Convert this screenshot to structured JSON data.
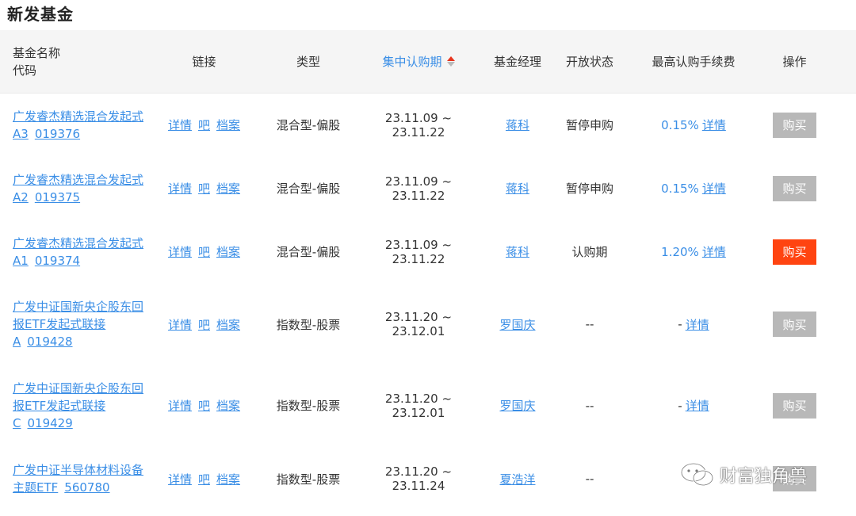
{
  "page_title": "新发基金",
  "headers": {
    "name": "基金名称",
    "code": "代码",
    "links": "链接",
    "type": "类型",
    "period": "集中认购期",
    "manager": "基金经理",
    "status": "开放状态",
    "fee": "最高认购手续费",
    "op": "操作"
  },
  "link_labels": {
    "detail": "详情",
    "bar": "吧",
    "archive": "档案"
  },
  "buy_label": "购买",
  "fee_detail_label": "详情",
  "watermark_text": "财富独角兽",
  "funds": [
    {
      "name": "广发睿杰精选混合发起式A3",
      "code": "019376",
      "type": "混合型-偏股",
      "period": "23.11.09 ~ 23.11.22",
      "manager": "蒋科",
      "status": "暂停申购",
      "fee": "0.15%",
      "buy_active": false
    },
    {
      "name": "广发睿杰精选混合发起式A2",
      "code": "019375",
      "type": "混合型-偏股",
      "period": "23.11.09 ~ 23.11.22",
      "manager": "蒋科",
      "status": "暂停申购",
      "fee": "0.15%",
      "buy_active": false
    },
    {
      "name": "广发睿杰精选混合发起式A1",
      "code": "019374",
      "type": "混合型-偏股",
      "period": "23.11.09 ~ 23.11.22",
      "manager": "蒋科",
      "status": "认购期",
      "fee": "1.20%",
      "buy_active": true
    },
    {
      "name": "广发中证国新央企股东回报ETF发起式联接A",
      "code": "019428",
      "type": "指数型-股票",
      "period": "23.11.20 ~ 23.12.01",
      "manager": "罗国庆",
      "status": "--",
      "fee": "-",
      "buy_active": false
    },
    {
      "name": "广发中证国新央企股东回报ETF发起式联接C",
      "code": "019429",
      "type": "指数型-股票",
      "period": "23.11.20 ~ 23.12.01",
      "manager": "罗国庆",
      "status": "--",
      "fee": "-",
      "buy_active": false
    },
    {
      "name": "广发中证半导体材料设备主题ETF",
      "code": "560780",
      "type": "指数型-股票",
      "period": "23.11.20 ~ 23.11.24",
      "manager": "夏浩洋",
      "status": "--",
      "fee": "",
      "buy_active": false
    }
  ],
  "colors": {
    "link": "#3a8ee6",
    "buy_active": "#ff4411",
    "buy_disabled": "#b8b8b8",
    "sort_up": "#e8341d"
  }
}
